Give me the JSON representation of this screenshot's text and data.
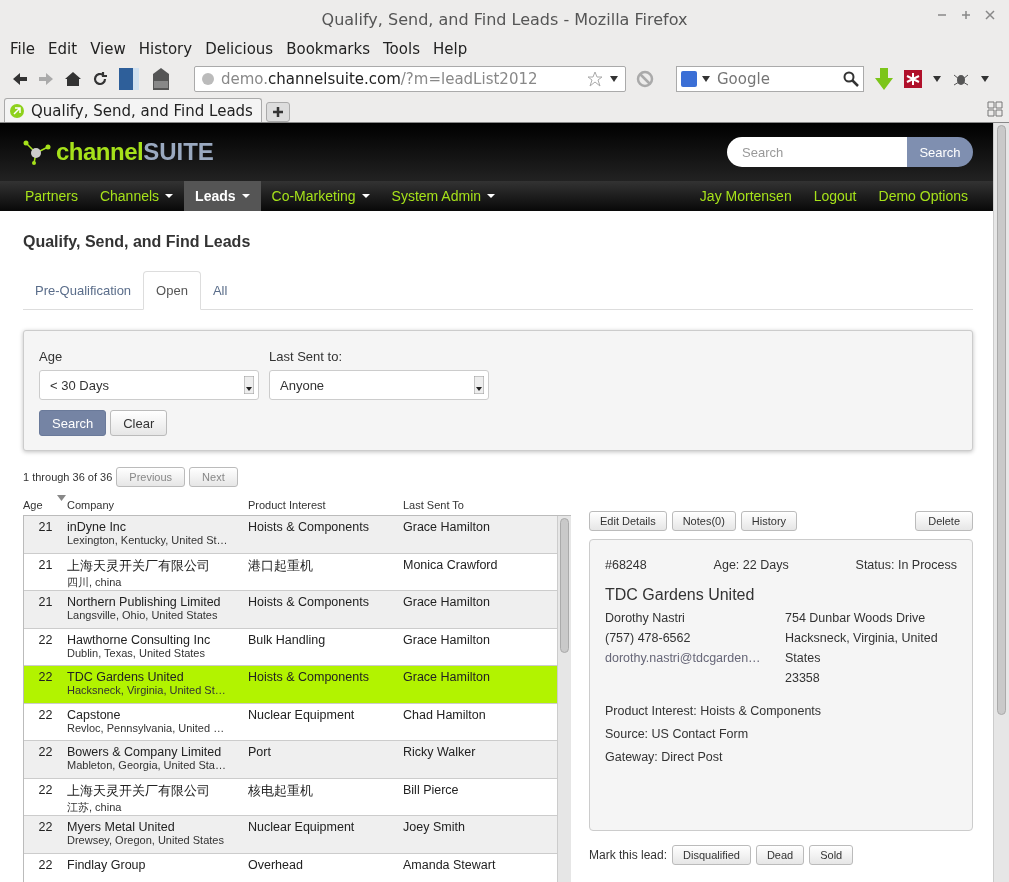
{
  "window": {
    "title": "Qualify, Send, and Find Leads - Mozilla Firefox"
  },
  "menu": [
    "File",
    "Edit",
    "View",
    "History",
    "Delicious",
    "Bookmarks",
    "Tools",
    "Help"
  ],
  "address_bar": {
    "host_prefix": "demo.",
    "domain": "channelsuite.com",
    "path": "/?m=leadList2012"
  },
  "search_bar": {
    "placeholder": "Google"
  },
  "browser_tabs": [
    {
      "label": "Qualify, Send, and Find Leads",
      "selected": true
    }
  ],
  "site_header": {
    "logo_plain": "channel",
    "logo_bold": "SUITE",
    "search_placeholder": "Search",
    "search_button": "Search"
  },
  "nav": {
    "left": [
      {
        "label": "Partners",
        "dropdown": false,
        "selected": false
      },
      {
        "label": "Channels",
        "dropdown": true,
        "selected": false
      },
      {
        "label": "Leads",
        "dropdown": true,
        "selected": true
      },
      {
        "label": "Co-Marketing",
        "dropdown": true,
        "selected": false
      },
      {
        "label": "System Admin",
        "dropdown": true,
        "selected": false
      }
    ],
    "right": [
      "Jay Mortensen",
      "Logout",
      "Demo Options"
    ]
  },
  "page_title": "Qualify, Send, and Find Leads",
  "tabs": [
    {
      "label": "Pre-Qualification",
      "selected": false
    },
    {
      "label": "Open",
      "selected": true
    },
    {
      "label": "All",
      "selected": false
    }
  ],
  "filters": {
    "fields": [
      {
        "label": "Age",
        "value": "< 30 Days"
      },
      {
        "label": "Last Sent to:",
        "value": "Anyone"
      }
    ],
    "search_button": "Search",
    "clear_button": "Clear"
  },
  "pager": {
    "summary": "1 through 36 of 36",
    "previous": "Previous",
    "next": "Next"
  },
  "table": {
    "columns": [
      "Age",
      "Company",
      "Product Interest",
      "Last Sent To"
    ],
    "rows": [
      {
        "age": "21",
        "company": "inDyne Inc",
        "location": "Lexington, Kentucky, United St…",
        "product": "Hoists & Components",
        "sent_to": "Grace Hamilton",
        "selected": false
      },
      {
        "age": "21",
        "company": "上海天灵开关厂有限公司",
        "location": "四川, china",
        "product": "港口起重机",
        "sent_to": "Monica Crawford",
        "selected": false
      },
      {
        "age": "21",
        "company": "Northern Publishing Limited",
        "location": "Langsville, Ohio, United States",
        "product": "Hoists & Components",
        "sent_to": "Grace Hamilton",
        "selected": false
      },
      {
        "age": "22",
        "company": "Hawthorne Consulting Inc",
        "location": "Dublin, Texas, United States",
        "product": "Bulk Handling",
        "sent_to": "Grace Hamilton",
        "selected": false
      },
      {
        "age": "22",
        "company": "TDC Gardens United",
        "location": "Hacksneck, Virginia, United St…",
        "product": "Hoists & Components",
        "sent_to": "Grace Hamilton",
        "selected": true
      },
      {
        "age": "22",
        "company": "Capstone",
        "location": "Revloc, Pennsylvania, United …",
        "product": "Nuclear Equipment",
        "sent_to": "Chad Hamilton",
        "selected": false
      },
      {
        "age": "22",
        "company": "Bowers & Company Limited",
        "location": "Mableton, Georgia, United Sta…",
        "product": "Port",
        "sent_to": "Ricky Walker",
        "selected": false
      },
      {
        "age": "22",
        "company": "上海天灵开关厂有限公司",
        "location": "江苏, china",
        "product": "核电起重机",
        "sent_to": "Bill Pierce",
        "selected": false
      },
      {
        "age": "22",
        "company": "Myers Metal United",
        "location": "Drewsey, Oregon, United States",
        "product": "Nuclear Equipment",
        "sent_to": "Joey Smith",
        "selected": false
      },
      {
        "age": "22",
        "company": "Findlay Group",
        "product": "Overhead",
        "sent_to": "Amanda Stewart",
        "selected": false
      }
    ]
  },
  "detail": {
    "actions": [
      "Edit Details",
      "Notes(0)",
      "History"
    ],
    "delete": "Delete",
    "id": "#68248",
    "age": "Age: 22 Days",
    "status": "Status: In Process",
    "company": "TDC Gardens United",
    "contact": [
      "Dorothy Nastri",
      "(757) 478-6562"
    ],
    "email": "dorothy.nastri@tdcgarden…",
    "address": [
      "754 Dunbar Woods Drive",
      "Hacksneck, Virginia, United States",
      "23358"
    ],
    "facts": [
      "Product Interest: Hoists & Components",
      "Source: US Contact Form",
      "Gateway: Direct Post"
    ],
    "mark_label": "Mark this lead:",
    "mark_buttons": [
      "Disqualified",
      "Dead",
      "Sold"
    ]
  }
}
